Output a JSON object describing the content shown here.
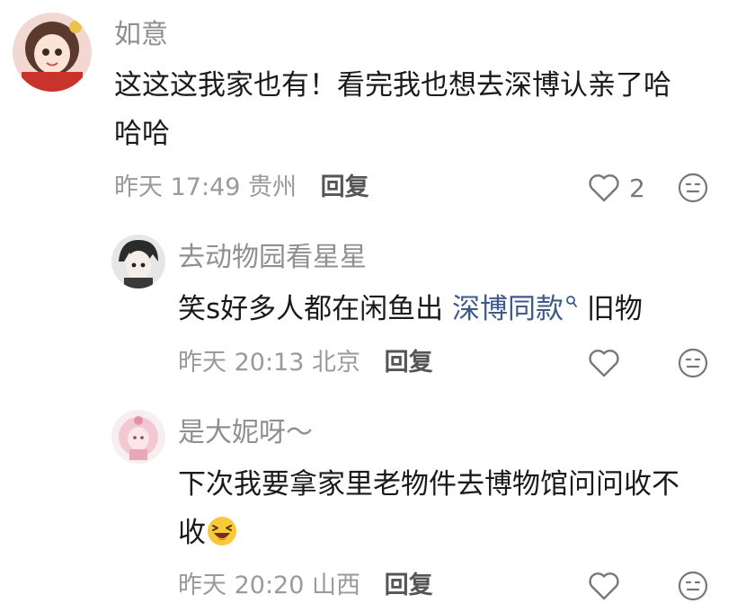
{
  "comments": [
    {
      "username": "如意",
      "content_line1": "这这这我家也有！看完我也想去深博认亲了哈",
      "content_line2": "哈哈",
      "time": "昨天 17:49",
      "location": "贵州",
      "reply_label": "回复",
      "like_count": "2"
    },
    {
      "username": "去动物园看星星",
      "content_pre": "笑s好多人都在闲鱼出",
      "content_link": "深博同款",
      "content_post": "旧物",
      "time": "昨天 20:13",
      "location": "北京",
      "reply_label": "回复"
    },
    {
      "username": "是大妮呀～",
      "content_line1": "下次我要拿家里老物件去博物馆问问收不",
      "content_line2": "收",
      "time": "昨天 20:20",
      "location": "山西",
      "reply_label": "回复"
    }
  ],
  "icons": {
    "like": "heart-outline-icon",
    "dislike": "meh-face-icon",
    "search": "search-icon",
    "laugh": "laughing-emoji-icon"
  },
  "colors": {
    "link": "#3d5a89",
    "meta": "#9a9a9a",
    "username": "#8f8f8f"
  }
}
